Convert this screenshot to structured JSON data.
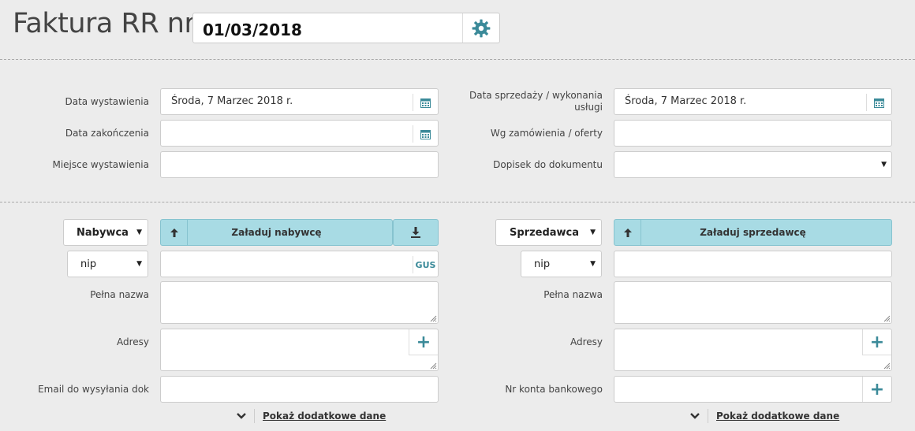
{
  "header": {
    "title": "Faktura RR nr",
    "doc_number": "01/03/2018"
  },
  "dates": {
    "issue_label": "Data wystawienia",
    "issue_value": "Środa, 7 Marzec 2018 r.",
    "end_label": "Data zakończenia",
    "end_value": "",
    "place_label": "Miejsce wystawienia",
    "place_value": "",
    "sale_label_line1": "Data sprzedaży / wykonania",
    "sale_label_line2": "usługi",
    "sale_value": "Środa, 7 Marzec 2018 r.",
    "order_label": "Wg zamówienia / oferty",
    "order_value": "",
    "note_label": "Dopisek do dokumentu",
    "note_value": ""
  },
  "buyer": {
    "role_select": "Nabywca",
    "load_button": "Załaduj nabywcę",
    "id_type": "nip",
    "id_value": "",
    "gus_label": "GUS",
    "full_name_label": "Pełna nazwa",
    "address_label": "Adresy",
    "email_label": "Email do wysyłania dok",
    "more_link": "Pokaż dodatkowe dane"
  },
  "seller": {
    "role_select": "Sprzedawca",
    "load_button": "Załaduj sprzedawcę",
    "id_type": "nip",
    "id_value": "",
    "full_name_label": "Pełna nazwa",
    "address_label": "Adresy",
    "bank_label": "Nr konta bankowego",
    "more_link": "Pokaż dodatkowe dane"
  },
  "colors": {
    "accent": "#3b8a99",
    "button": "#a8dbe4",
    "background": "#ececec"
  },
  "icons": [
    "gear-icon",
    "calendar-icon",
    "arrow-up-icon",
    "download-icon",
    "plus-icon",
    "chevron-down-icon"
  ]
}
